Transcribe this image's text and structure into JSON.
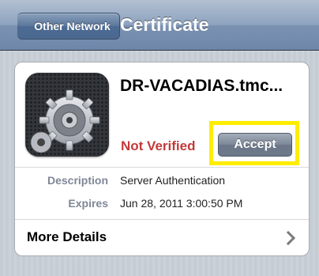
{
  "navbar": {
    "back_label": "Other Network",
    "title": "Certificate"
  },
  "certificate": {
    "icon": "gears-icon",
    "name": "DR-VACADIAS.tmc...",
    "status": "Not Verified",
    "accept_label": "Accept",
    "details": [
      {
        "label": "Description",
        "value": "Server Authentication"
      },
      {
        "label": "Expires",
        "value": "Jun 28, 2011 3:00:50 PM"
      }
    ],
    "more_details_label": "More Details"
  },
  "colors": {
    "status_red": "#c23a3a",
    "highlight": "#ffed00",
    "navbar": "#7b92b2"
  }
}
